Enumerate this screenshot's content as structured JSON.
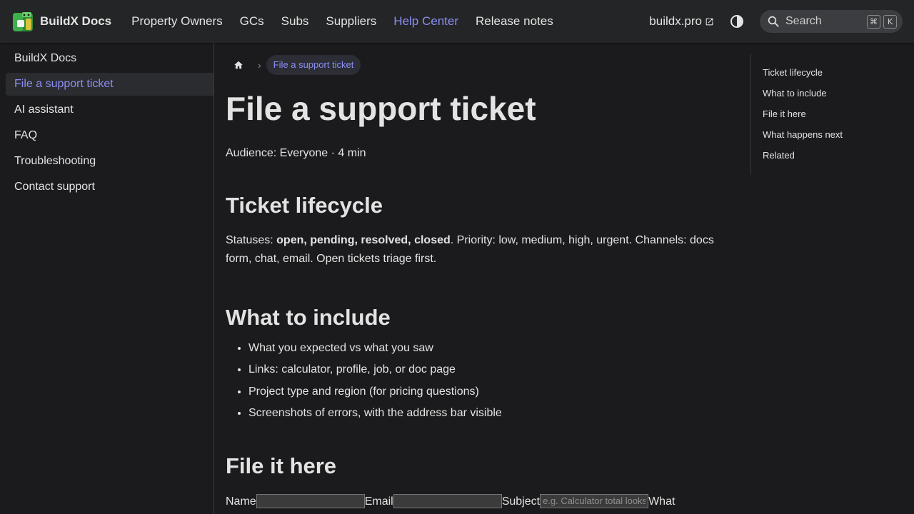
{
  "navbar": {
    "brand": "BuildX Docs",
    "links": [
      "Property Owners",
      "GCs",
      "Subs",
      "Suppliers",
      "Help Center",
      "Release notes"
    ],
    "external_link": "buildx.pro",
    "search_placeholder": "Search",
    "search_keys": [
      "⌘",
      "K"
    ]
  },
  "sidebar": {
    "items": [
      "BuildX Docs",
      "File a support ticket",
      "AI assistant",
      "FAQ",
      "Troubleshooting",
      "Contact support"
    ]
  },
  "breadcrumb": {
    "current": "File a support ticket"
  },
  "page": {
    "title": "File a support ticket",
    "meta": "Audience: Everyone · 4 min",
    "sections": {
      "lifecycle": {
        "heading": "Ticket lifecycle",
        "text_before": "Statuses: ",
        "statuses": "open, pending, resolved, closed",
        "text_after": ". Priority: low, medium, high, urgent. Channels: docs form, chat, email. Open tickets triage first."
      },
      "include": {
        "heading": "What to include",
        "items": [
          "What you expected vs what you saw",
          "Links: calculator, profile, job, or doc page",
          "Project type and region (for pricing questions)",
          "Screenshots of errors, with the address bar visible"
        ]
      },
      "file": {
        "heading": "File it here",
        "form": {
          "name_label": "Name",
          "email_label": "Email",
          "subject_label": "Subject",
          "subject_placeholder": "e.g. Calculator total looks off",
          "next_label": "What"
        }
      }
    }
  },
  "toc": {
    "items": [
      "Ticket lifecycle",
      "What to include",
      "File it here",
      "What happens next",
      "Related"
    ]
  },
  "colors": {
    "accent": "#8b8ff5",
    "background": "#1b1b1d",
    "navbar": "#242526"
  }
}
